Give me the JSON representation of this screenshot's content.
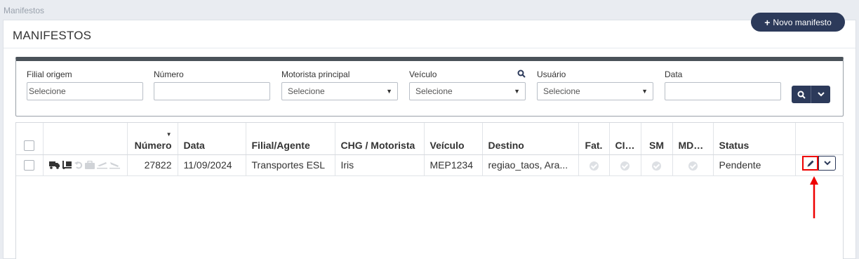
{
  "breadcrumb": "Manifestos",
  "page_title": "MANIFESTOS",
  "new_button": {
    "icon": "plus-icon",
    "label": "Novo manifesto"
  },
  "filters": {
    "filial_origem": {
      "label": "Filial origem",
      "placeholder": "Selecione"
    },
    "numero": {
      "label": "Número",
      "value": ""
    },
    "motorista": {
      "label": "Motorista principal",
      "selected": "Selecione"
    },
    "veiculo": {
      "label": "Veículo",
      "selected": "Selecione"
    },
    "usuario": {
      "label": "Usuário",
      "selected": "Selecione"
    },
    "data": {
      "label": "Data",
      "value": ""
    }
  },
  "table": {
    "headers": [
      "",
      "",
      "Número",
      "Data",
      "Filial/Agente",
      "CHG / Motorista",
      "Veículo",
      "Destino",
      "Fat.",
      "CIOT",
      "SM",
      "MDF-e",
      "Status",
      ""
    ],
    "rows": [
      {
        "icons": [
          "truck-icon",
          "dolly-icon",
          "undo-icon",
          "briefcase-icon",
          "plane-departure-icon",
          "plane-arrival-icon"
        ],
        "numero": "27822",
        "data": "11/09/2024",
        "filial": "Transportes ESL",
        "motorista": "Iris",
        "veiculo": "MEP1234",
        "destino": "regiao_taos, Ara...",
        "status": "Pendente"
      }
    ]
  },
  "colors": {
    "primary": "#2c3a5a",
    "highlight": "#e00000"
  }
}
